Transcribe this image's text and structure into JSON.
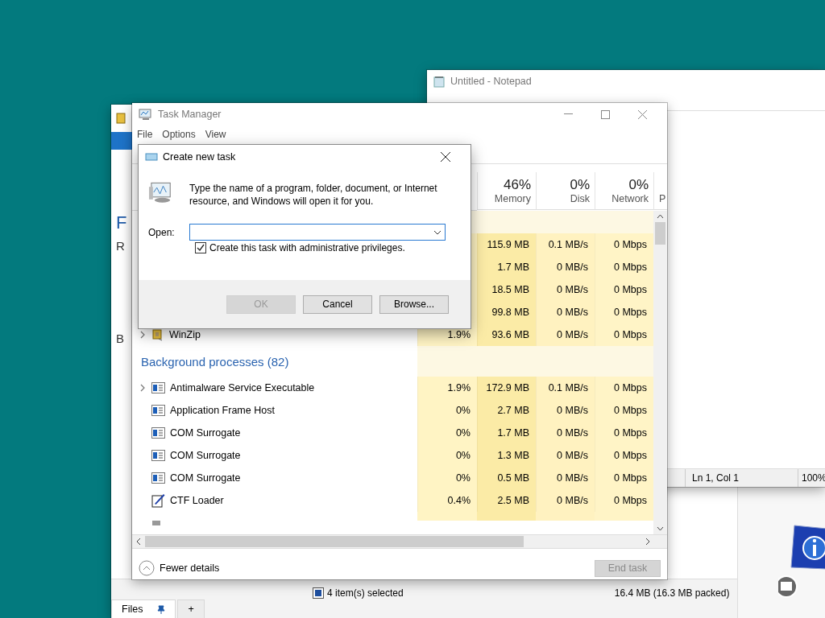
{
  "back_window": {
    "left_letters": [
      "F",
      "R",
      "B"
    ],
    "tabs": [
      {
        "label": "Files",
        "selected": true,
        "pinned": true
      },
      {
        "label": "+",
        "selected": false,
        "pinned": false
      }
    ],
    "status": [
      "4 item(s) selected",
      "16.4 MB (16.3 MB packed)"
    ]
  },
  "notepad": {
    "title": "Untitled - Notepad",
    "status": [
      "Ln 1, Col 1",
      "100%"
    ]
  },
  "task_manager": {
    "title": "Task Manager",
    "menu": [
      "File",
      "Options",
      "View"
    ],
    "columns": [
      {
        "percent": "46%",
        "label": "Memory"
      },
      {
        "percent": "0%",
        "label": "Disk"
      },
      {
        "percent": "0%",
        "label": "Network"
      },
      {
        "label": "P"
      }
    ],
    "groups": [
      {
        "rows": [
          {
            "memory": "115.9 MB",
            "disk": "0.1 MB/s",
            "network": "0 Mbps"
          },
          {
            "memory": "1.7 MB",
            "disk": "0 MB/s",
            "network": "0 Mbps"
          },
          {
            "memory": "18.5 MB",
            "disk": "0 MB/s",
            "network": "0 Mbps"
          },
          {
            "memory": "99.8 MB",
            "disk": "0 MB/s",
            "network": "0 Mbps"
          },
          {
            "name": "WinZip",
            "kind": "archive",
            "expandable": true,
            "cpu": "1.9%",
            "memory": "93.6 MB",
            "disk": "0 MB/s",
            "network": "0 Mbps"
          }
        ]
      },
      {
        "title": "Background processes (82)",
        "rows": [
          {
            "name": "Antimalware Service Executable",
            "kind": "service",
            "expandable": true,
            "cpu": "1.9%",
            "memory": "172.9 MB",
            "disk": "0.1 MB/s",
            "network": "0 Mbps"
          },
          {
            "name": "Application Frame Host",
            "kind": "service",
            "expandable": false,
            "cpu": "0%",
            "memory": "2.7 MB",
            "disk": "0 MB/s",
            "network": "0 Mbps"
          },
          {
            "name": "COM Surrogate",
            "kind": "service",
            "expandable": false,
            "cpu": "0%",
            "memory": "1.7 MB",
            "disk": "0 MB/s",
            "network": "0 Mbps"
          },
          {
            "name": "COM Surrogate",
            "kind": "service",
            "expandable": false,
            "cpu": "0%",
            "memory": "1.3 MB",
            "disk": "0 MB/s",
            "network": "0 Mbps"
          },
          {
            "name": "COM Surrogate",
            "kind": "service",
            "expandable": false,
            "cpu": "0%",
            "memory": "0.5 MB",
            "disk": "0 MB/s",
            "network": "0 Mbps"
          },
          {
            "name": "CTF Loader",
            "kind": "editor",
            "expandable": false,
            "cpu": "0.4%",
            "memory": "2.5 MB",
            "disk": "0 MB/s",
            "network": "0 Mbps"
          }
        ]
      }
    ],
    "fewer_details": "Fewer details",
    "end_task": {
      "label": "End task",
      "disabled": true
    }
  },
  "dialog": {
    "title": "Create new task",
    "message": "Type the name of a program, folder, document, or Internet resource, and Windows will open it for you.",
    "open_label": "Open:",
    "checkbox": {
      "label": "Create this task with administrative privileges.",
      "checked": true
    },
    "buttons": [
      {
        "label": "OK",
        "disabled": true
      },
      {
        "label": "Cancel",
        "disabled": false
      },
      {
        "label": "Browse...",
        "disabled": false
      }
    ]
  }
}
